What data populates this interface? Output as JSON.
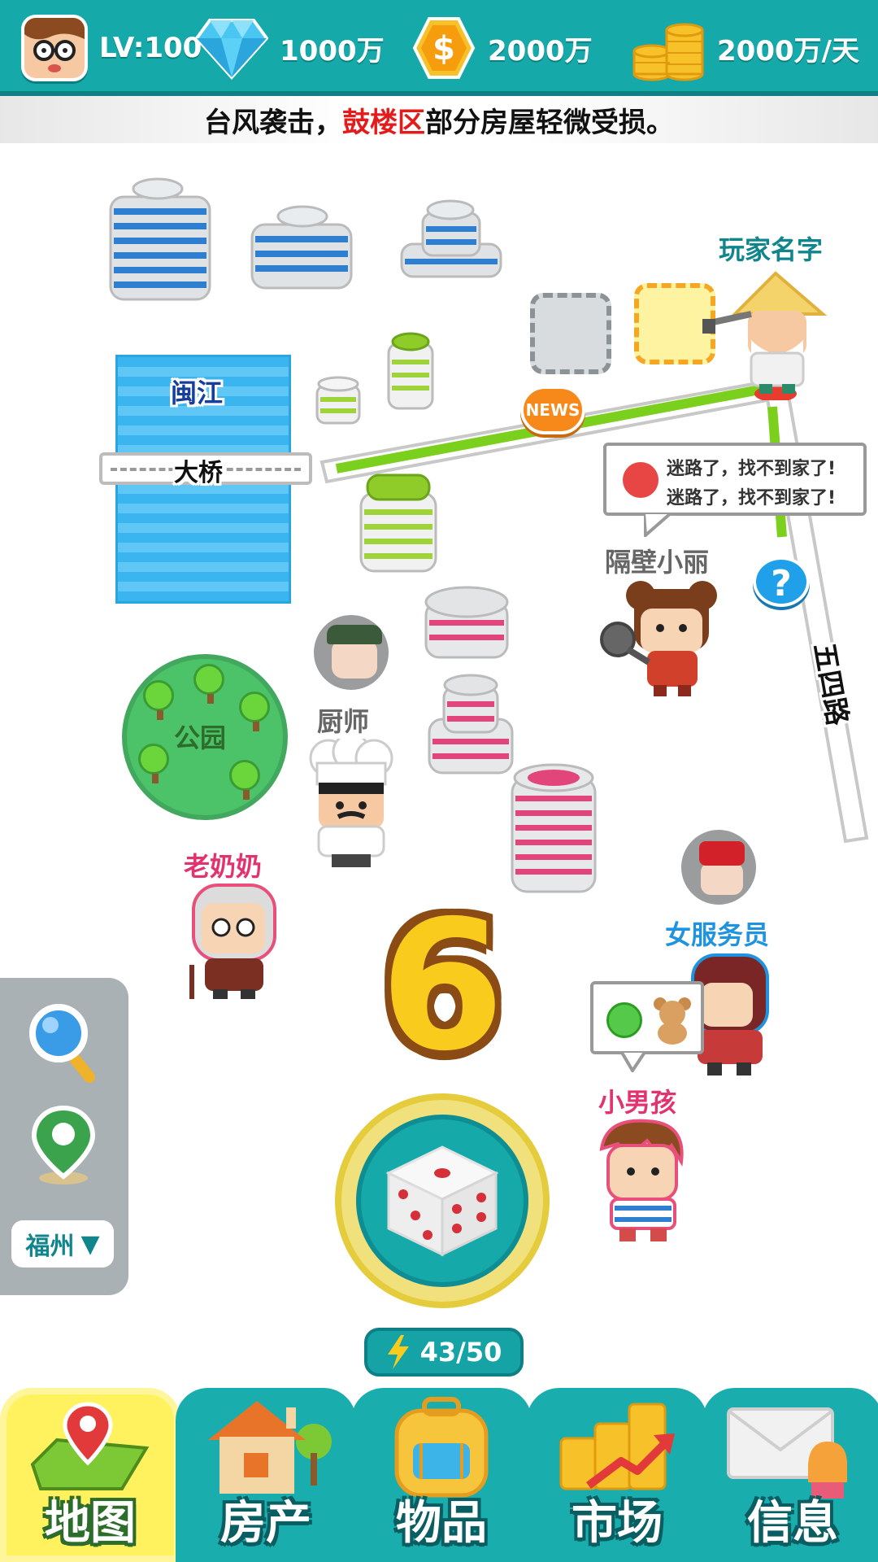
{
  "header": {
    "level": "LV:100",
    "diamonds": "1000万",
    "coins": "2000万",
    "income": "2000万/天"
  },
  "ticker": {
    "prefix": "台风袭击，",
    "district": "鼓楼区",
    "suffix": "部分房屋轻微受损。",
    "highlight_color": "#e31b1b"
  },
  "map": {
    "river_label": "闽江",
    "bridge_label": "大桥",
    "park_label": "公园",
    "road_label": "五四路",
    "news_label": "NEWS",
    "player_name": "玩家名字"
  },
  "npcs": {
    "neighbor": "隔壁小丽",
    "chef": "厨师",
    "grandma": "老奶奶",
    "waitress": "女服务员",
    "boy": "小男孩"
  },
  "speech": {
    "line1": "迷路了，找不到家了!",
    "line2": "迷路了，找不到家了!"
  },
  "dice": {
    "result": "6"
  },
  "energy": {
    "label": "43/50"
  },
  "side_panel": {
    "city": "福州",
    "city_arrow": "▼"
  },
  "nav": {
    "tabs": [
      {
        "label": "地图",
        "active": true
      },
      {
        "label": "房产",
        "active": false
      },
      {
        "label": "物品",
        "active": false
      },
      {
        "label": "市场",
        "active": false
      },
      {
        "label": "信息",
        "active": false
      }
    ]
  },
  "colors": {
    "teal": "#15a9a9",
    "nav_active": "#fff25e",
    "river": "#3bb5ef",
    "park": "#4cc269"
  }
}
